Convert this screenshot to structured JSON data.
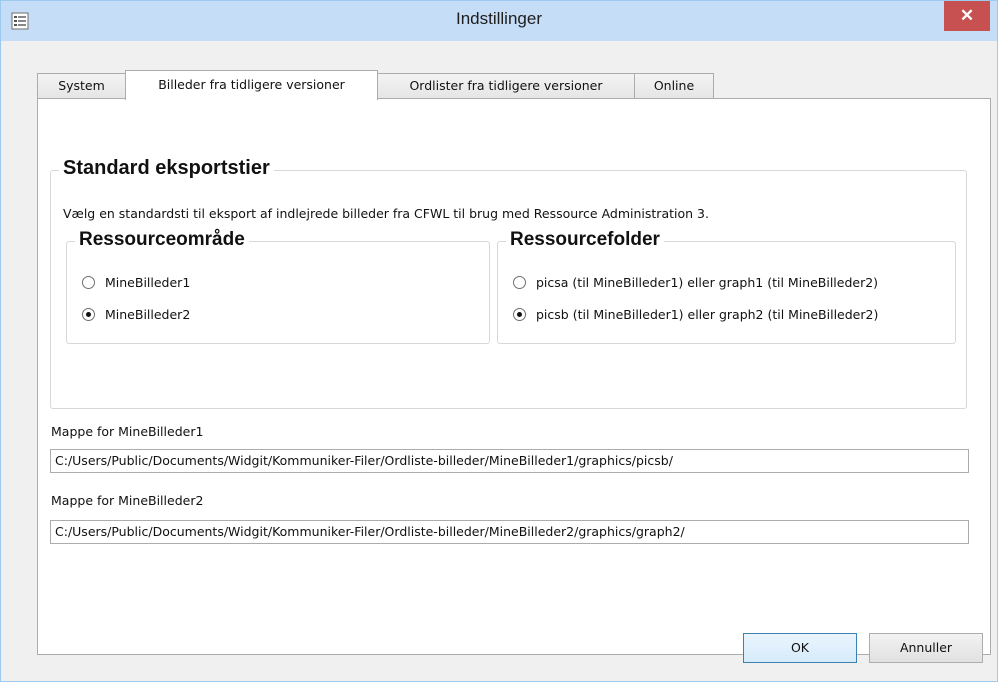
{
  "window": {
    "title": "Indstillinger",
    "close_label": "✕"
  },
  "tabs": [
    {
      "label": "System"
    },
    {
      "label": "Billeder fra tidligere versioner"
    },
    {
      "label": "Ordlister fra tidligere versioner"
    },
    {
      "label": "Online"
    }
  ],
  "active_tab": 1,
  "export": {
    "title": "Standard eksportstier",
    "description": "Vælg en standardsti til eksport af indlejrede billeder fra CFWL til brug med Ressource Administration 3.",
    "area": {
      "title": "Ressourceområde",
      "options": [
        {
          "label": "MineBilleder1",
          "checked": false
        },
        {
          "label": "MineBilleder2",
          "checked": true
        }
      ]
    },
    "folder": {
      "title": "Ressourcefolder",
      "options": [
        {
          "label": "picsa (til MineBilleder1) eller graph1 (til MineBilleder2)",
          "checked": false
        },
        {
          "label": "picsb (til MineBilleder1) eller graph2 (til MineBilleder2)",
          "checked": true
        }
      ]
    }
  },
  "paths": {
    "folder1_label": "Mappe for MineBilleder1",
    "folder1_value": "C:/Users/Public/Documents/Widgit/Kommuniker-Filer/Ordliste-billeder/MineBilleder1/graphics/picsb/",
    "folder2_label": "Mappe for MineBilleder2",
    "folder2_value": "C:/Users/Public/Documents/Widgit/Kommuniker-Filer/Ordliste-billeder/MineBilleder2/graphics/graph2/"
  },
  "buttons": {
    "ok": "OK",
    "cancel": "Annuller"
  }
}
